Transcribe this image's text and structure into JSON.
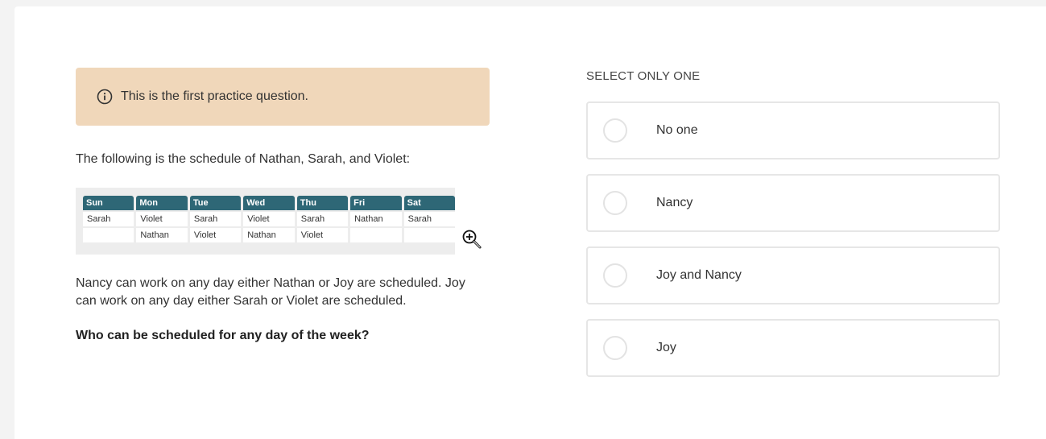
{
  "notice": {
    "text": "This is the first practice question.",
    "icon": "info-icon"
  },
  "intro": "The following is the schedule of Nathan, Sarah, and Violet:",
  "schedule": {
    "headers": [
      "Sun",
      "Mon",
      "Tue",
      "Wed",
      "Thu",
      "Fri",
      "Sat"
    ],
    "rows": [
      [
        "Sarah",
        "Violet",
        "Sarah",
        "Violet",
        "Sarah",
        "Nathan",
        "Sarah"
      ],
      [
        "",
        "Nathan",
        "Violet",
        "Nathan",
        "Violet",
        "",
        ""
      ]
    ],
    "header_color": "#2e6776"
  },
  "zoom_icon": "zoom-in-icon",
  "rules": "Nancy can work on any day either Nathan or Joy are scheduled. Joy can work on any day either Sarah or Violet are scheduled.",
  "question": "Who can be scheduled for any day of the week?",
  "answers": {
    "instruction": "SELECT ONLY ONE",
    "options": [
      {
        "label": "No one",
        "selected": false
      },
      {
        "label": "Nancy",
        "selected": false
      },
      {
        "label": "Joy and Nancy",
        "selected": false
      },
      {
        "label": "Joy",
        "selected": false
      }
    ]
  },
  "colors": {
    "notice_bg": "#f0d7ba",
    "card_bg": "#ffffff",
    "page_bg": "#f3f3f3"
  }
}
